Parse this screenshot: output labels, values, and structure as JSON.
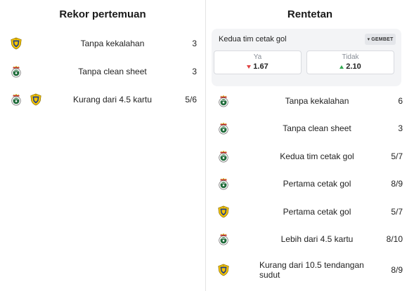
{
  "left": {
    "title": "Rekor pertemuan",
    "rows": [
      {
        "label": "Tanpa kekalahan",
        "value": "3",
        "teams": [
          "villarreal"
        ]
      },
      {
        "label": "Tanpa clean sheet",
        "value": "3",
        "teams": [
          "racing"
        ]
      },
      {
        "label": "Kurang dari 4.5 kartu",
        "value": "5/6",
        "teams": [
          "racing",
          "villarreal"
        ]
      }
    ]
  },
  "right": {
    "title": "Rentetan",
    "odds": {
      "title": "Kedua tim cetak gol",
      "brand": "GEMBET",
      "yes_label": "Ya",
      "yes_value": "1.67",
      "no_label": "Tidak",
      "no_value": "2.10"
    },
    "rows": [
      {
        "label": "Tanpa kekalahan",
        "value": "6",
        "teams": [
          "racing"
        ]
      },
      {
        "label": "Tanpa clean sheet",
        "value": "3",
        "teams": [
          "racing"
        ]
      },
      {
        "label": "Kedua tim cetak gol",
        "value": "5/7",
        "teams": [
          "racing"
        ]
      },
      {
        "label": "Pertama cetak gol",
        "value": "8/9",
        "teams": [
          "racing"
        ]
      },
      {
        "label": "Pertama cetak gol",
        "value": "5/7",
        "teams": [
          "villarreal"
        ]
      },
      {
        "label": "Lebih dari 4.5 kartu",
        "value": "8/10",
        "teams": [
          "racing"
        ]
      },
      {
        "label": "Kurang dari 10.5 tendangan sudut",
        "value": "8/9",
        "teams": [
          "villarreal"
        ]
      }
    ]
  },
  "colors": {
    "villarreal_yellow": "#f5c400",
    "villarreal_blue": "#1f3f8c",
    "racing_green": "#1f6b3a",
    "racing_red": "#c8302c",
    "odds_down": "#e04040",
    "odds_up": "#2fa84f"
  }
}
